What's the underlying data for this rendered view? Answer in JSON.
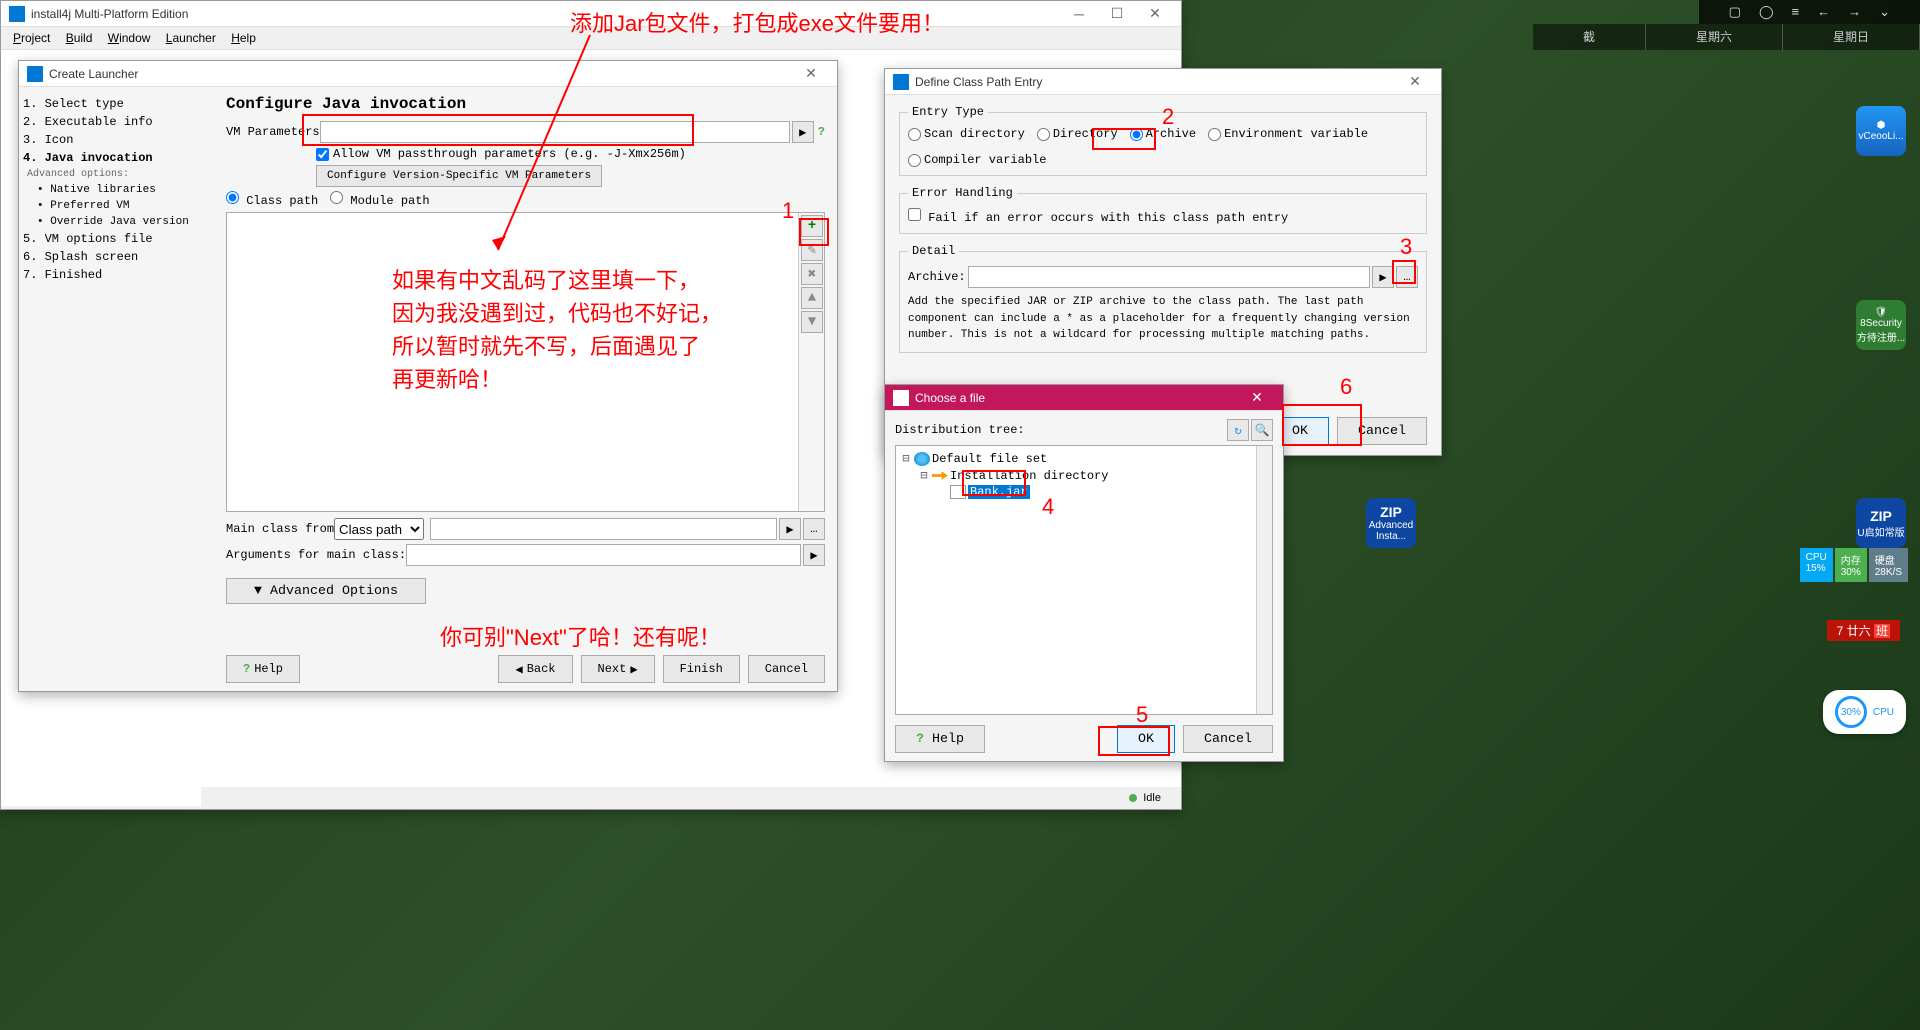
{
  "main_window": {
    "title": "install4j Multi-Platform Edition",
    "menu": {
      "project": "Project",
      "build": "Build",
      "window": "Window",
      "launcher": "Launcher",
      "help": "Help"
    },
    "status_idle": "Idle"
  },
  "launcher": {
    "title": "Create Launcher",
    "steps": {
      "s1": "1. Select type",
      "s2": "2. Executable info",
      "s3": "3. Icon",
      "s4": "4. Java invocation",
      "adv_header": "Advanced options:",
      "adv1": "• Native libraries",
      "adv2": "• Preferred VM",
      "adv3": "• Override Java version",
      "s5": "5. VM options file",
      "s6": "6. Splash screen",
      "s7": "7. Finished"
    },
    "heading": "Configure Java invocation",
    "vm_params_label": "VM Parameters",
    "allow_passthrough": "Allow VM passthrough parameters (e.g. -J-Xmx256m)",
    "config_version_btn": "Configure Version-Specific VM Parameters",
    "class_path": "Class path",
    "module_path": "Module path",
    "main_class_label": "Main class from",
    "main_class_select": "Class path",
    "args_label": "Arguments for main class:",
    "adv_options_btn": "▼  Advanced Options",
    "help_btn": "Help",
    "back_btn": "Back",
    "next_btn": "Next",
    "finish_btn": "Finish",
    "cancel_btn": "Cancel"
  },
  "classpath": {
    "title": "Define Class Path Entry",
    "entry_type_legend": "Entry Type",
    "scan_dir": "Scan directory",
    "directory": "Directory",
    "archive": "Archive",
    "env_var": "Environment variable",
    "comp_var": "Compiler variable",
    "error_legend": "Error Handling",
    "fail_if": "Fail if an error occurs with this class path entry",
    "detail_legend": "Detail",
    "archive_label": "Archive:",
    "detail_text": "Add the specified JAR or ZIP archive to the class path. The last path component can include a * as a placeholder for a frequently changing version number. This is not a wildcard for processing multiple matching paths.",
    "ok_btn": "OK",
    "cancel_btn": "Cancel"
  },
  "file_dialog": {
    "title": "Choose a file",
    "dist_tree_label": "Distribution tree:",
    "root": "Default file set",
    "install_dir": "Installation directory",
    "file": "Bank.jar",
    "help_btn": "Help",
    "ok_btn": "OK",
    "cancel_btn": "Cancel"
  },
  "annotations": {
    "top": "添加Jar包文件，打包成exe文件要用！",
    "middle": "如果有中文乱码了这里填一下，\n因为我没遇到过，代码也不好记，\n所以暂时就先不写，后面遇见了\n再更新哈！",
    "bottom": "你可别\"Next\"了哈！还有呢！",
    "n1": "1",
    "n2": "2",
    "n3": "3",
    "n4": "4",
    "n5": "5",
    "n6": "6"
  },
  "taskbar": {
    "week_interrupted": "截",
    "saturday": "星期六",
    "sunday": "星期日"
  },
  "sidebar_right": {
    "ceoo": "vCeooLi...",
    "security": "8Security",
    "security2": "方待注册...",
    "zip1": "Advanced Insta...",
    "zip2": "U启如常版",
    "cpu": "CPU",
    "cpu_val": "15%",
    "mem": "内存",
    "mem_val": "30%",
    "disk": "硬盘",
    "disk_val": "28K/S",
    "date": "7 廿六",
    "percent": "30%",
    "cpu_label": "CPU"
  }
}
